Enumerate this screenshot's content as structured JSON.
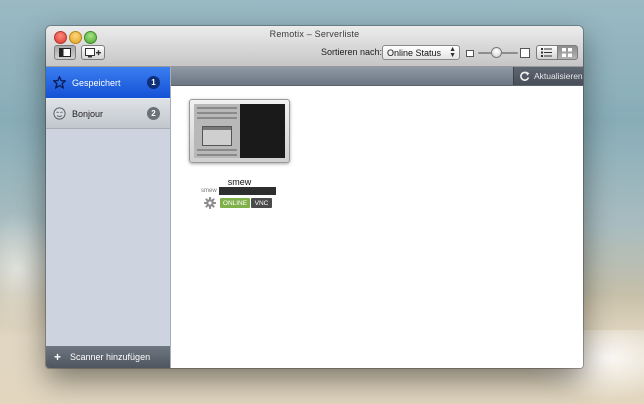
{
  "window": {
    "title": "Remotix – Serverliste"
  },
  "toolbar": {
    "sort_label": "Sortieren nach:",
    "sort_value": "Online Status",
    "sidebar_toggle_icon": "sidebar-icon",
    "add_server_icon": "monitor-plus-icon",
    "view_list_icon": "list-icon",
    "view_grid_icon": "grid-icon",
    "zoom_level": 0.45
  },
  "sidebar": {
    "items": [
      {
        "label": "Gespeichert",
        "count": "1",
        "icon": "star-icon",
        "active": true
      },
      {
        "label": "Bonjour",
        "count": "2",
        "icon": "bonjour-icon",
        "active": false
      }
    ],
    "footer_label": "Scanner hinzufügen",
    "footer_icon": "plus-icon"
  },
  "content_bar": {
    "refresh_label": "Aktualisieren",
    "refresh_icon": "refresh-icon"
  },
  "servers": [
    {
      "name": "smew",
      "host_label": "smew",
      "status": "ONLINE",
      "protocol": "VNC"
    }
  ],
  "colors": {
    "accent": "#1451d6",
    "online": "#7fb04a",
    "protocol": "#4a4a4a"
  }
}
